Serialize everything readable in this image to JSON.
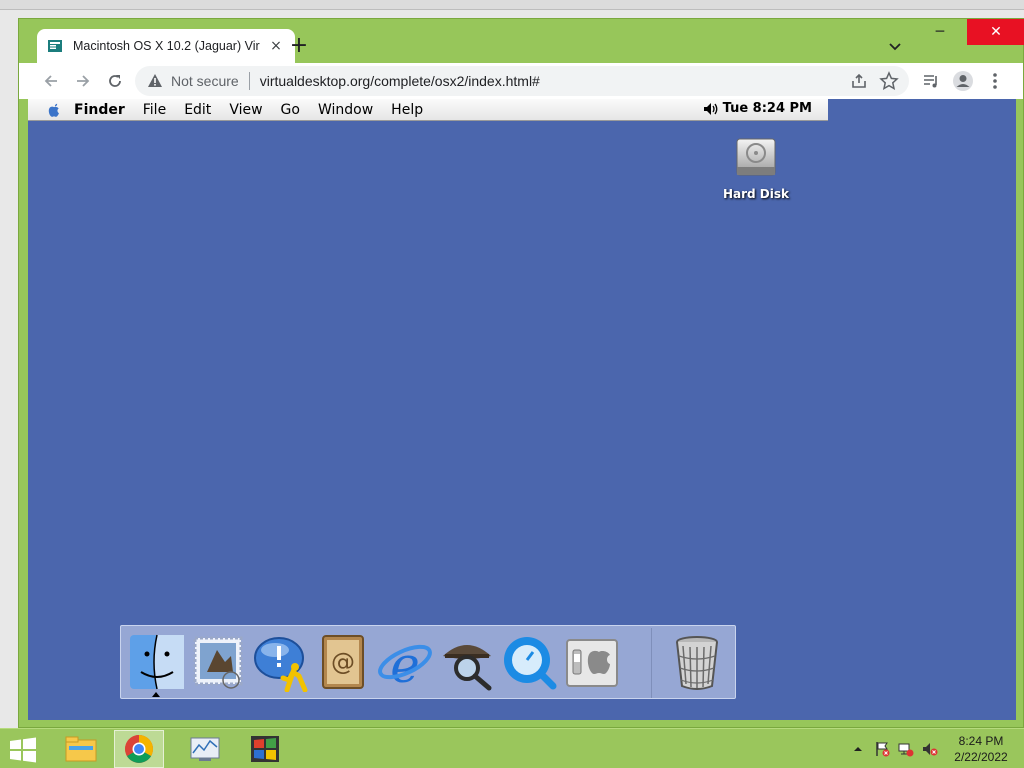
{
  "browser": {
    "tab": {
      "title": "Macintosh OS X 10.2 (Jaguar) Vir",
      "close_icon": "×"
    },
    "newtab_icon": "+",
    "window_controls": {
      "minimize": "─",
      "maximize": "☐",
      "close": "✕"
    },
    "omnibox": {
      "security_text": "Not secure",
      "url": "virtualdesktop.org/complete/osx2/index.html#"
    }
  },
  "mac": {
    "menubar": {
      "app": "Finder",
      "items": [
        "File",
        "Edit",
        "View",
        "Go",
        "Window",
        "Help"
      ],
      "clock": "Tue 8:24 PM"
    },
    "desktop_icons": [
      {
        "label": "Hard Disk",
        "icon": "hard-disk-icon"
      }
    ],
    "dock": {
      "items": [
        "finder-icon",
        "mail-icon",
        "ichat-icon",
        "address-book-icon",
        "internet-explorer-icon",
        "sherlock-icon",
        "quicktime-icon",
        "system-preferences-icon",
        "trash-icon"
      ]
    }
  },
  "taskbar": {
    "apps": [
      "file-explorer-icon",
      "chrome-icon",
      "performance-monitor-icon",
      "windows-logo-icon"
    ],
    "time": "8:24 PM",
    "date": "2/22/2022"
  },
  "colors": {
    "window_frame": "#97c65a",
    "desktop_bg": "#4b66ad",
    "close_red": "#e81123"
  }
}
